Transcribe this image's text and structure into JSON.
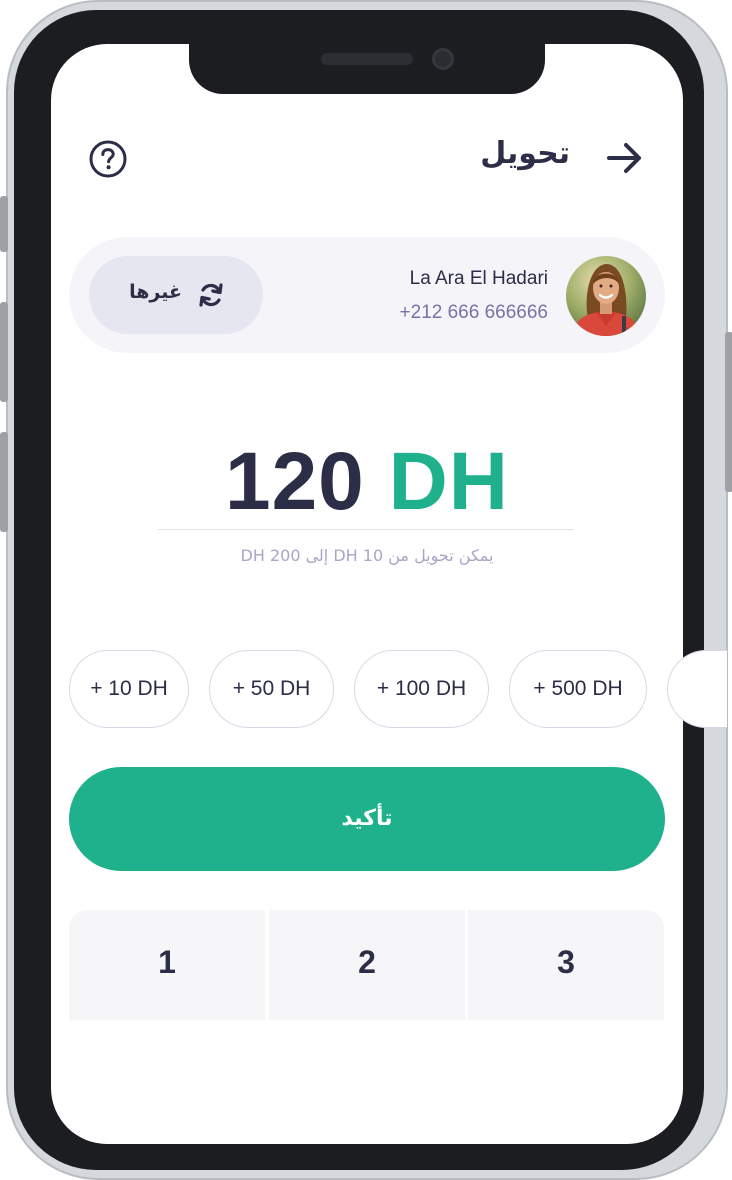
{
  "header": {
    "title": "تحويل",
    "back_icon": "arrow-right-icon",
    "help_icon": "question-circle-icon"
  },
  "recipient": {
    "name": "La Ara El Hadari",
    "phone": "+212 666 666666",
    "change_label": "غيرها",
    "change_icon": "refresh-icon"
  },
  "amount": {
    "value": "120",
    "currency": "DH",
    "limit_text": "يمكن تحويل من 10 DH إلى 200 DH"
  },
  "quick_amounts": [
    "+ 10 DH",
    "+ 50 DH",
    "+ 100 DH",
    "+ 500 DH",
    ""
  ],
  "confirm_label": "تأكيد",
  "keypad": {
    "keys": [
      "1",
      "2",
      "3"
    ]
  },
  "colors": {
    "accent": "#1eb18c",
    "text_dark": "#2c2d47",
    "text_muted": "#7b71a7",
    "card_bg": "#f5f5f9"
  }
}
